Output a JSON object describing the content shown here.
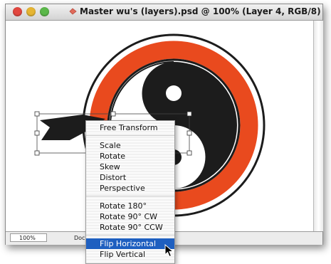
{
  "window": {
    "title": "Master wu's (layers).psd @ 100% (Layer 4, RGB/8)"
  },
  "status_bar": {
    "zoom": "100%",
    "doc_label": "Doc"
  },
  "context_menu": {
    "items": [
      "Free Transform",
      "Scale",
      "Rotate",
      "Skew",
      "Distort",
      "Perspective",
      "Rotate 180°",
      "Rotate 90° CW",
      "Rotate 90° CCW",
      "Flip Horizontal",
      "Flip Vertical"
    ],
    "selected": "Flip Horizontal"
  },
  "colors": {
    "logo_red": "#e94a1e",
    "logo_dark": "#1c1c1c",
    "menu_highlight": "#1e5fc0"
  },
  "icons": {
    "close": "close-button-icon",
    "minimize": "minimize-button-icon",
    "zoom": "zoom-button-icon",
    "document": "psd-document-icon",
    "cursor": "arrow-cursor-icon"
  }
}
